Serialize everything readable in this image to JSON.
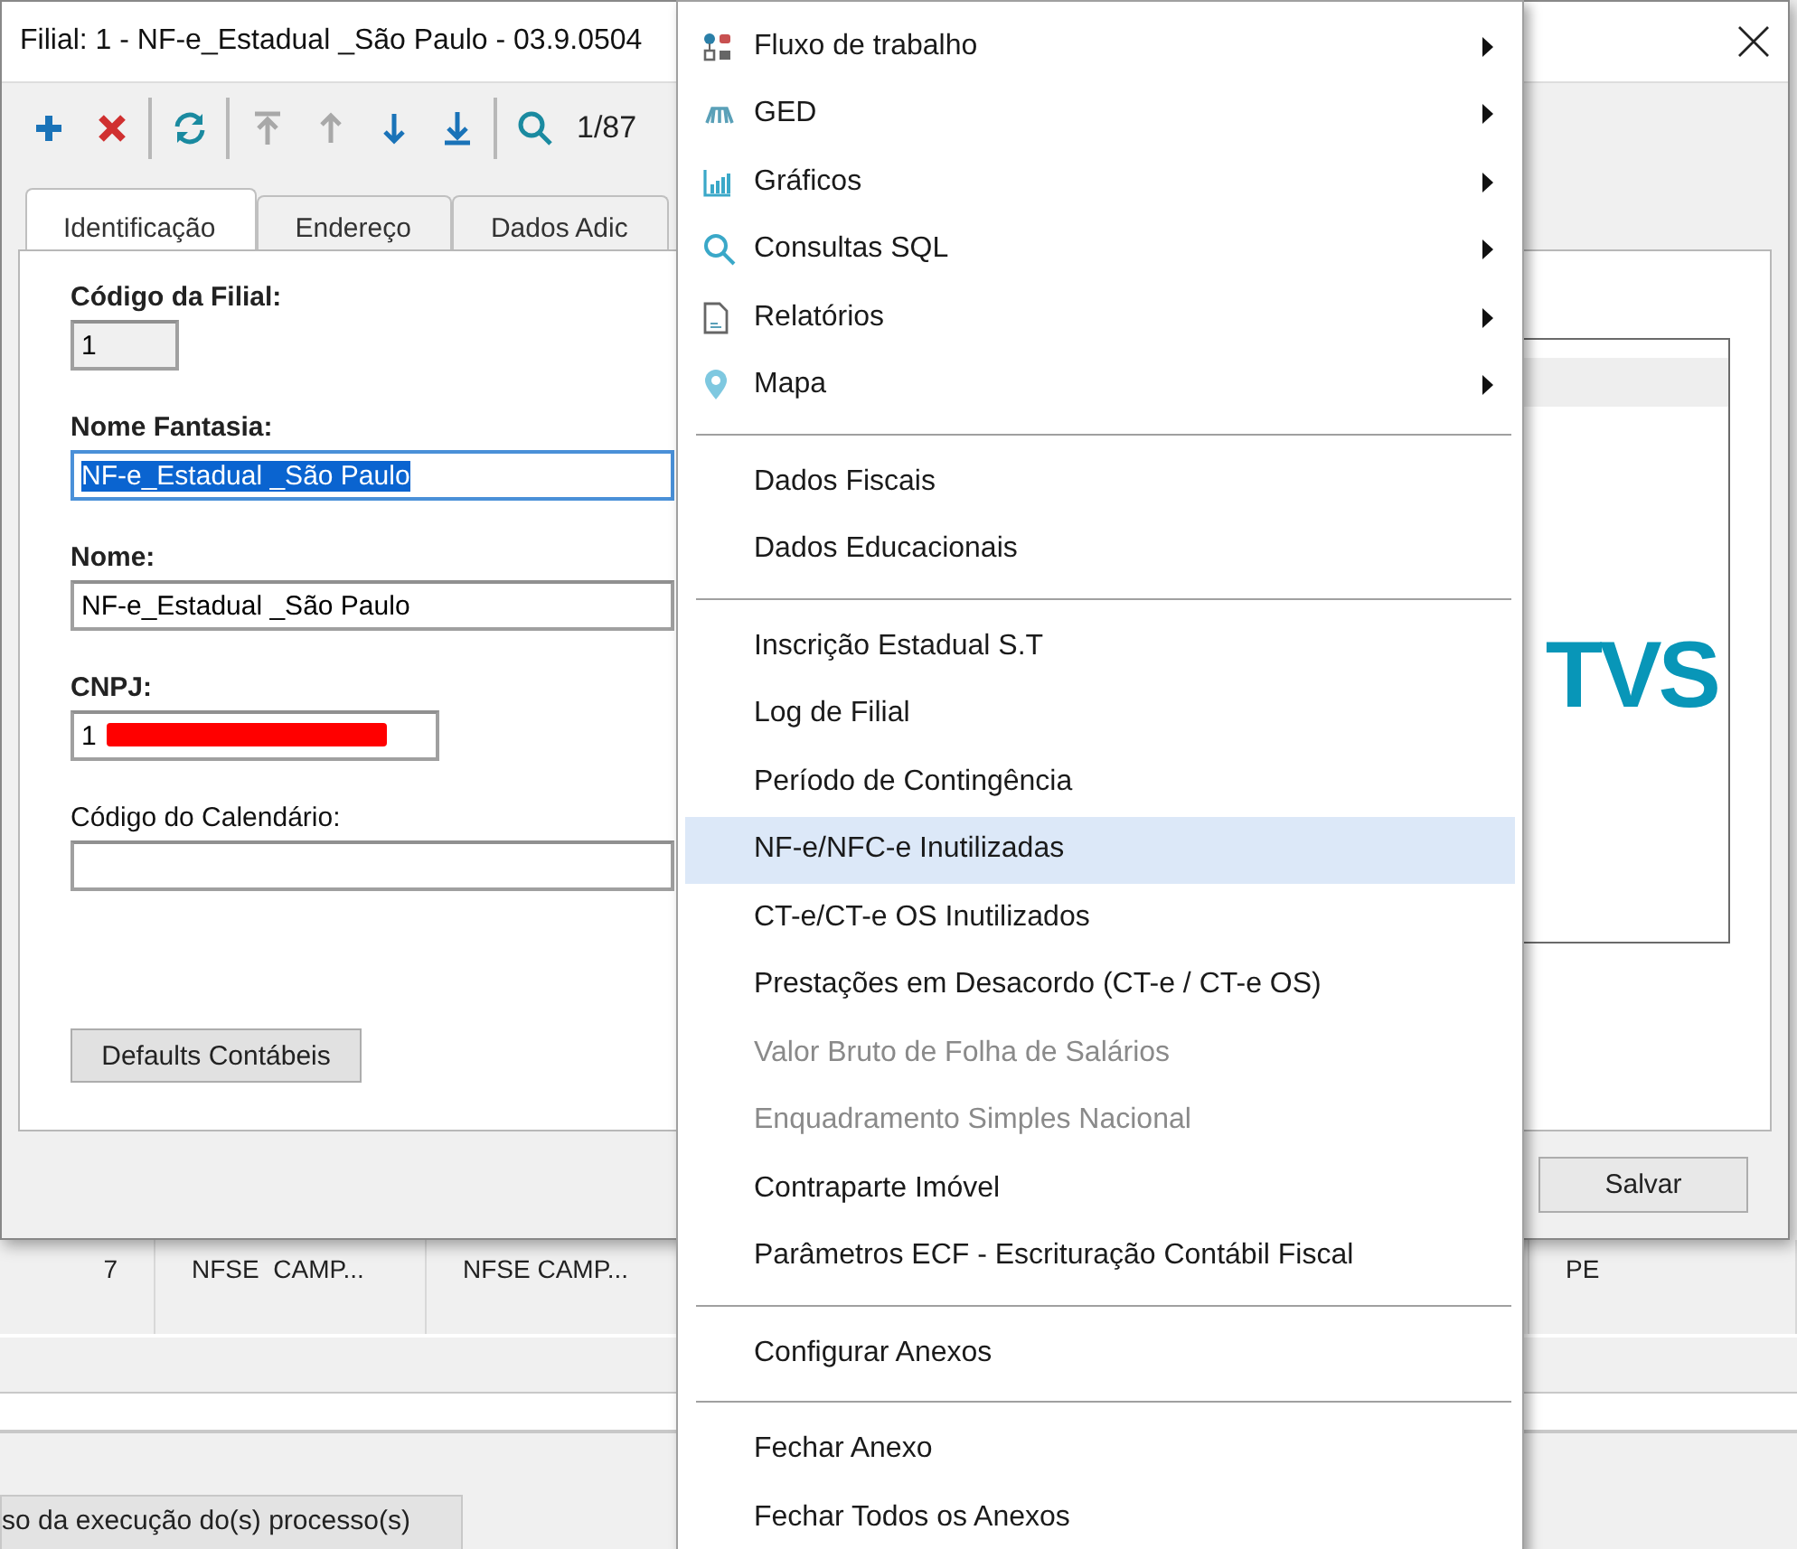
{
  "background": {
    "table_row": [
      "7",
      "NFSE  CAMP...",
      "NFSE CAMP...",
      "PE"
    ],
    "status_tab": "so da execução do(s) processo(s)"
  },
  "dialog": {
    "title": "Filial: 1 - NF-e_Estadual _São Paulo - 03.9.0504",
    "toolbar": [
      {
        "kind": "add",
        "disabled": false
      },
      {
        "kind": "delete",
        "disabled": false
      },
      {
        "kind": "separator"
      },
      {
        "kind": "refresh",
        "disabled": false
      },
      {
        "kind": "separator"
      },
      {
        "kind": "first",
        "disabled": true
      },
      {
        "kind": "previous",
        "disabled": true
      },
      {
        "kind": "next",
        "disabled": false
      },
      {
        "kind": "last",
        "disabled": false
      },
      {
        "kind": "separator"
      },
      {
        "kind": "search",
        "disabled": false
      }
    ],
    "record_counter": "1/87",
    "tabs": [
      {
        "label": "Identificação",
        "selected": true
      },
      {
        "label": "Endereço",
        "selected": false
      },
      {
        "label": "Dados Adic",
        "selected": false
      }
    ],
    "fields": [
      {
        "label": "Código da Filial:",
        "value": "1",
        "required": true,
        "readonly": true,
        "text_selected": false,
        "redacted": false
      },
      {
        "label": "Nome Fantasia:",
        "value": "NF-e_Estadual _São Paulo",
        "required": true,
        "readonly": false,
        "text_selected": true,
        "redacted": false
      },
      {
        "label": "Nome:",
        "value": "NF-e_Estadual _São Paulo",
        "required": true,
        "readonly": false,
        "text_selected": false,
        "redacted": false
      },
      {
        "label": "CNPJ:",
        "value": "1",
        "required": true,
        "readonly": false,
        "text_selected": false,
        "redacted": true
      },
      {
        "label": "Código do Calendário:",
        "required": false,
        "readonly": false,
        "text_selected": false,
        "redacted": false
      }
    ],
    "panel_button": "Defaults Contábeis",
    "logo_text": "TVS",
    "save_button": "Salvar"
  },
  "menu": {
    "groups": [
      [
        {
          "label": "Fluxo de trabalho",
          "submenu": true,
          "disabled": false,
          "selected": false
        },
        {
          "label": "GED",
          "submenu": true,
          "disabled": false,
          "selected": false
        },
        {
          "label": "Gráficos",
          "submenu": true,
          "disabled": false,
          "selected": false
        },
        {
          "label": "Consultas SQL",
          "submenu": true,
          "disabled": false,
          "selected": false
        },
        {
          "label": "Relatórios",
          "submenu": true,
          "disabled": false,
          "selected": false
        },
        {
          "label": "Mapa",
          "submenu": true,
          "disabled": false,
          "selected": false
        }
      ],
      [
        {
          "label": "Dados Fiscais",
          "submenu": false,
          "disabled": false,
          "selected": false
        },
        {
          "label": "Dados Educacionais",
          "submenu": false,
          "disabled": false,
          "selected": false
        }
      ],
      [
        {
          "label": "Inscrição Estadual S.T",
          "submenu": false,
          "disabled": false,
          "selected": false
        },
        {
          "label": "Log de Filial",
          "submenu": false,
          "disabled": false,
          "selected": false
        },
        {
          "label": "Período de Contingência",
          "submenu": false,
          "disabled": false,
          "selected": false
        },
        {
          "label": "NF-e/NFC-e Inutilizadas",
          "submenu": false,
          "disabled": false,
          "selected": true
        },
        {
          "label": "CT-e/CT-e OS Inutilizados",
          "submenu": false,
          "disabled": false,
          "selected": false
        },
        {
          "label": "Prestações em Desacordo (CT-e / CT-e OS)",
          "submenu": false,
          "disabled": false,
          "selected": false
        },
        {
          "label": "Valor Bruto de Folha de Salários",
          "submenu": false,
          "disabled": true,
          "selected": false
        },
        {
          "label": "Enquadramento Simples Nacional",
          "submenu": false,
          "disabled": true,
          "selected": false
        },
        {
          "label": "Contraparte Imóvel",
          "submenu": false,
          "disabled": false,
          "selected": false
        },
        {
          "label": "Parâmetros ECF - Escrituração Contábil Fiscal",
          "submenu": false,
          "disabled": false,
          "selected": false
        }
      ],
      [
        {
          "label": "Configurar Anexos",
          "submenu": false,
          "disabled": false,
          "selected": false
        }
      ],
      [
        {
          "label": "Fechar Anexo",
          "submenu": false,
          "disabled": false,
          "selected": false
        },
        {
          "label": "Fechar Todos os Anexos",
          "submenu": false,
          "disabled": false,
          "selected": false
        }
      ]
    ]
  }
}
